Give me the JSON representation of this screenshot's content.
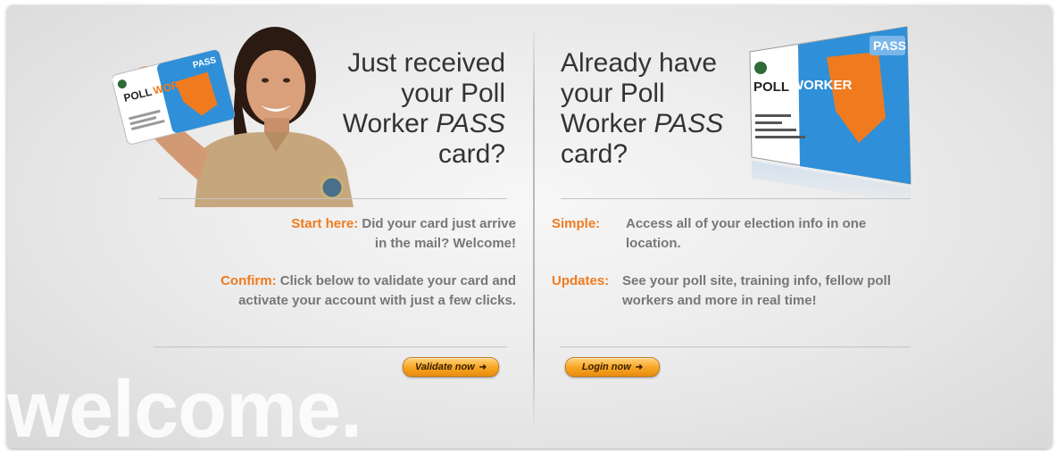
{
  "left": {
    "headline_1": "Just received",
    "headline_2": "your Poll",
    "headline_3a": "Worker ",
    "headline_3b": "PASS",
    "headline_4": "card?",
    "item1_key": "Start here:",
    "item1_text_a": " Did your card just arrive",
    "item1_text_b": "in the mail?  Welcome!",
    "item2_key": "Confirm:",
    "item2_text_a": " Click below to validate your card and",
    "item2_text_b": "activate your account with just a few clicks.",
    "button_label": "Validate now",
    "card_line1": "POLL",
    "card_line2": "WORKER",
    "card_line3": "PASS"
  },
  "right": {
    "headline_1": "Already have",
    "headline_2": "your Poll",
    "headline_3a": "Worker ",
    "headline_3b": "PASS",
    "headline_4": "card?",
    "item1_key": "Simple:",
    "item1_text": "Access all of your election info in one location.",
    "item2_key": "Updates:",
    "item2_text": "See your poll site, training info, fellow poll workers and more in real time!",
    "button_label": "Login now",
    "card_poll": "POLL",
    "card_worker": "WORKER",
    "card_pass": "PASS"
  },
  "watermark": "welcome.",
  "colors": {
    "accent": "#f07b1e",
    "button": "#f7a422",
    "card_blue": "#2f8fd8",
    "card_orange": "#f07b1e"
  }
}
